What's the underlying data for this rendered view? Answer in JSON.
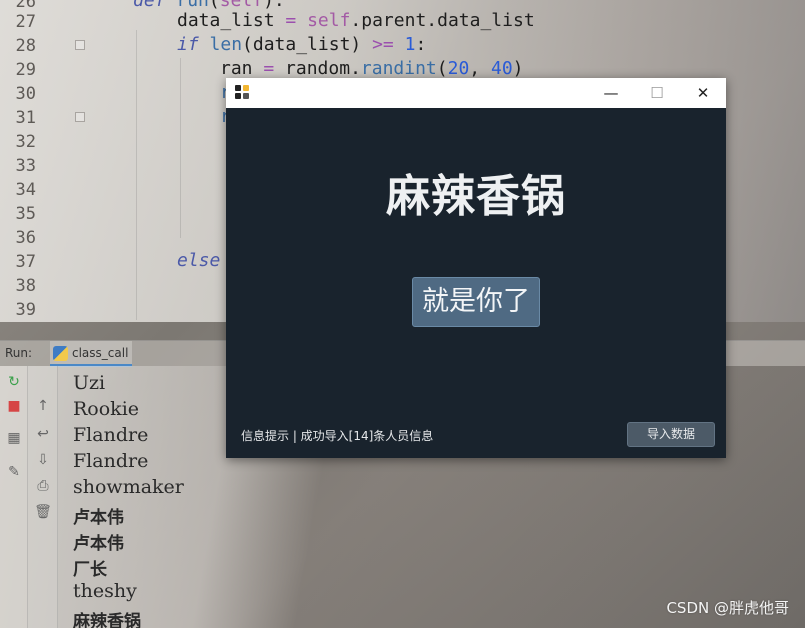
{
  "editor": {
    "line_numbers": [
      "26",
      "27",
      "28",
      "29",
      "30",
      "31",
      "32",
      "33",
      "34",
      "35",
      "36",
      "37",
      "38",
      "39"
    ],
    "lines": {
      "l26": [
        "def ",
        "run",
        "(",
        "self",
        "):"
      ],
      "l27": [
        "data_list ",
        "= ",
        "self",
        ".parent.data_list"
      ],
      "l28": [
        "if ",
        "len",
        "(data_list) ",
        ">= ",
        "1",
        ":"
      ],
      "l29": [
        "ran ",
        "= ",
        "random.",
        "randint",
        "(",
        "20",
        ", ",
        "40",
        ")"
      ],
      "l30": "r",
      "l31": "r",
      "l37": "else"
    }
  },
  "run": {
    "label": "Run:",
    "tab_label": "class_call",
    "output": [
      "Uzi",
      "Rookie",
      "Flandre",
      "Flandre",
      "showmaker",
      "卢本伟",
      "卢本伟",
      "厂长",
      "theshy",
      "麻辣香锅"
    ]
  },
  "app": {
    "title_text": "麻辣香锅",
    "pick_button_label": "就是你了",
    "status_text": "信息提示 | 成功导入[14]条人员信息",
    "import_button_label": "导入数据",
    "window_controls": {
      "minimize": "—",
      "maximize": "☐",
      "close": "✕"
    },
    "colors": {
      "background": "#19232d",
      "button": "#4f6a83",
      "import_button": "#4c5a67"
    }
  },
  "watermark": "CSDN @胖虎他哥"
}
